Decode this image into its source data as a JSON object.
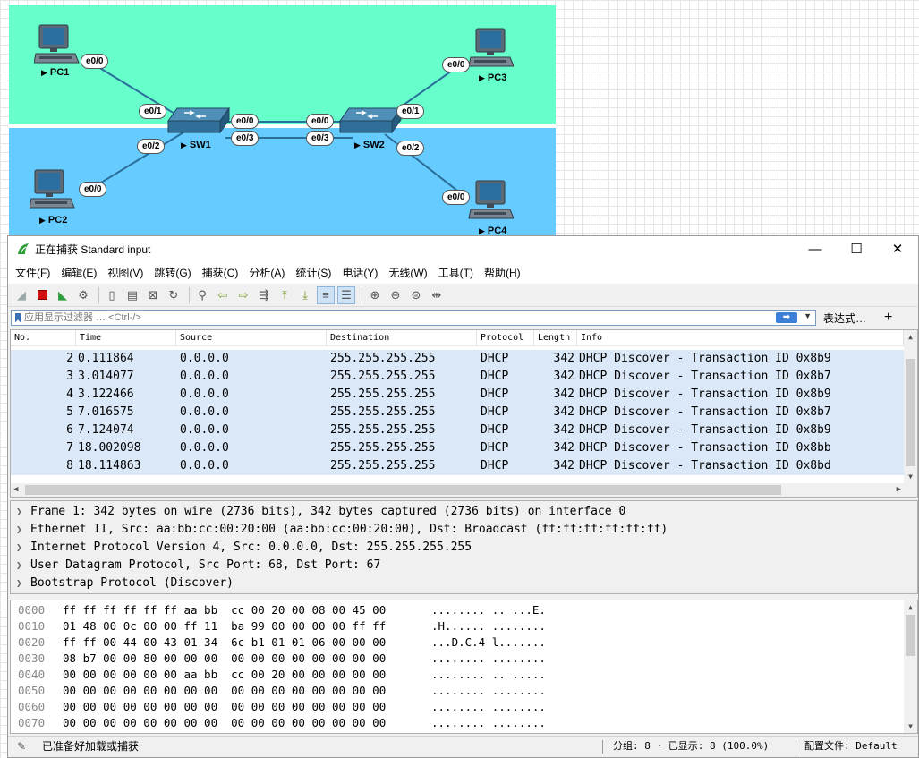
{
  "topology": {
    "zone_colors": {
      "top": "#66ffcc",
      "bottom": "#66ccff"
    },
    "link_color": "#2a6e9a",
    "devices": {
      "pc1": {
        "label": "PC1"
      },
      "pc2": {
        "label": "PC2"
      },
      "pc3": {
        "label": "PC3"
      },
      "pc4": {
        "label": "PC4"
      },
      "sw1": {
        "label": "SW1"
      },
      "sw2": {
        "label": "SW2"
      }
    },
    "ports": {
      "pc1_e00": "e0/0",
      "sw1_e01": "e0/1",
      "sw1_e02": "e0/2",
      "pc2_e00": "e0/0",
      "sw1_e00": "e0/0",
      "sw1_e03": "e0/3",
      "sw2_e00": "e0/0",
      "sw2_e03": "e0/3",
      "sw2_e01": "e0/1",
      "pc3_e00": "e0/0",
      "sw2_e02": "e0/2",
      "pc4_e00": "e0/0"
    }
  },
  "window": {
    "title": "正在捕获 Standard input",
    "controls": {
      "minimize": "—",
      "maximize": "☐",
      "close": "✕"
    }
  },
  "menu": [
    "文件(F)",
    "编辑(E)",
    "视图(V)",
    "跳转(G)",
    "捕获(C)",
    "分析(A)",
    "统计(S)",
    "电话(Y)",
    "无线(W)",
    "工具(T)",
    "帮助(H)"
  ],
  "toolbar_icons": [
    "shark-fin-icon",
    "stop-capture-icon",
    "restart-capture-icon",
    "capture-options-icon",
    "open-file-icon",
    "save-file-icon",
    "close-file-icon",
    "reload-file-icon",
    "find-packet-icon",
    "go-back-icon",
    "go-forward-icon",
    "go-to-packet-icon",
    "go-first-icon",
    "go-last-icon",
    "autoscroll-icon",
    "colorize-icon",
    "zoom-in-icon",
    "zoom-out-icon",
    "zoom-normal-icon",
    "resize-columns-icon"
  ],
  "filter": {
    "placeholder": "应用显示过滤器 … <Ctrl-/>",
    "value": "",
    "expression_label": "表达式…",
    "add_label": "+"
  },
  "packet_list": {
    "columns": [
      "No.",
      "Time",
      "Source",
      "Destination",
      "Protocol",
      "Length",
      "Info"
    ],
    "rows": [
      {
        "no": "2",
        "time": "0.111864",
        "src": "0.0.0.0",
        "dst": "255.255.255.255",
        "proto": "DHCP",
        "len": "342",
        "info": "DHCP Discover - Transaction ID 0x8b9"
      },
      {
        "no": "3",
        "time": "3.014077",
        "src": "0.0.0.0",
        "dst": "255.255.255.255",
        "proto": "DHCP",
        "len": "342",
        "info": "DHCP Discover - Transaction ID 0x8b7"
      },
      {
        "no": "4",
        "time": "3.122466",
        "src": "0.0.0.0",
        "dst": "255.255.255.255",
        "proto": "DHCP",
        "len": "342",
        "info": "DHCP Discover - Transaction ID 0x8b9"
      },
      {
        "no": "5",
        "time": "7.016575",
        "src": "0.0.0.0",
        "dst": "255.255.255.255",
        "proto": "DHCP",
        "len": "342",
        "info": "DHCP Discover - Transaction ID 0x8b7"
      },
      {
        "no": "6",
        "time": "7.124074",
        "src": "0.0.0.0",
        "dst": "255.255.255.255",
        "proto": "DHCP",
        "len": "342",
        "info": "DHCP Discover - Transaction ID 0x8b9"
      },
      {
        "no": "7",
        "time": "18.002098",
        "src": "0.0.0.0",
        "dst": "255.255.255.255",
        "proto": "DHCP",
        "len": "342",
        "info": "DHCP Discover - Transaction ID 0x8bb"
      },
      {
        "no": "8",
        "time": "18.114863",
        "src": "0.0.0.0",
        "dst": "255.255.255.255",
        "proto": "DHCP",
        "len": "342",
        "info": "DHCP Discover - Transaction ID 0x8bd"
      }
    ],
    "row_color": "#dae8f8"
  },
  "details": [
    "Frame 1: 342 bytes on wire (2736 bits), 342 bytes captured (2736 bits) on interface 0",
    "Ethernet II, Src: aa:bb:cc:00:20:00 (aa:bb:cc:00:20:00), Dst: Broadcast (ff:ff:ff:ff:ff:ff)",
    "Internet Protocol Version 4, Src: 0.0.0.0, Dst: 255.255.255.255",
    "User Datagram Protocol, Src Port: 68, Dst Port: 67",
    "Bootstrap Protocol (Discover)"
  ],
  "hex_dump": [
    {
      "off": "0000",
      "hex": "ff ff ff ff ff ff aa bb  cc 00 20 00 08 00 45 00",
      "ascii": "........ .. ...E."
    },
    {
      "off": "0010",
      "hex": "01 48 00 0c 00 00 ff 11  ba 99 00 00 00 00 ff ff",
      "ascii": ".H...... ........"
    },
    {
      "off": "0020",
      "hex": "ff ff 00 44 00 43 01 34  6c b1 01 01 06 00 00 00",
      "ascii": "...D.C.4 l......."
    },
    {
      "off": "0030",
      "hex": "08 b7 00 00 80 00 00 00  00 00 00 00 00 00 00 00",
      "ascii": "........ ........"
    },
    {
      "off": "0040",
      "hex": "00 00 00 00 00 00 aa bb  cc 00 20 00 00 00 00 00",
      "ascii": "........ .. ....."
    },
    {
      "off": "0050",
      "hex": "00 00 00 00 00 00 00 00  00 00 00 00 00 00 00 00",
      "ascii": "........ ........"
    },
    {
      "off": "0060",
      "hex": "00 00 00 00 00 00 00 00  00 00 00 00 00 00 00 00",
      "ascii": "........ ........"
    },
    {
      "off": "0070",
      "hex": "00 00 00 00 00 00 00 00  00 00 00 00 00 00 00 00",
      "ascii": "........ ........"
    }
  ],
  "status": {
    "ready": "已准备好加载或捕获",
    "packets": "分组: 8 · 已显示: 8 (100.0%)",
    "profile": "配置文件: Default"
  }
}
